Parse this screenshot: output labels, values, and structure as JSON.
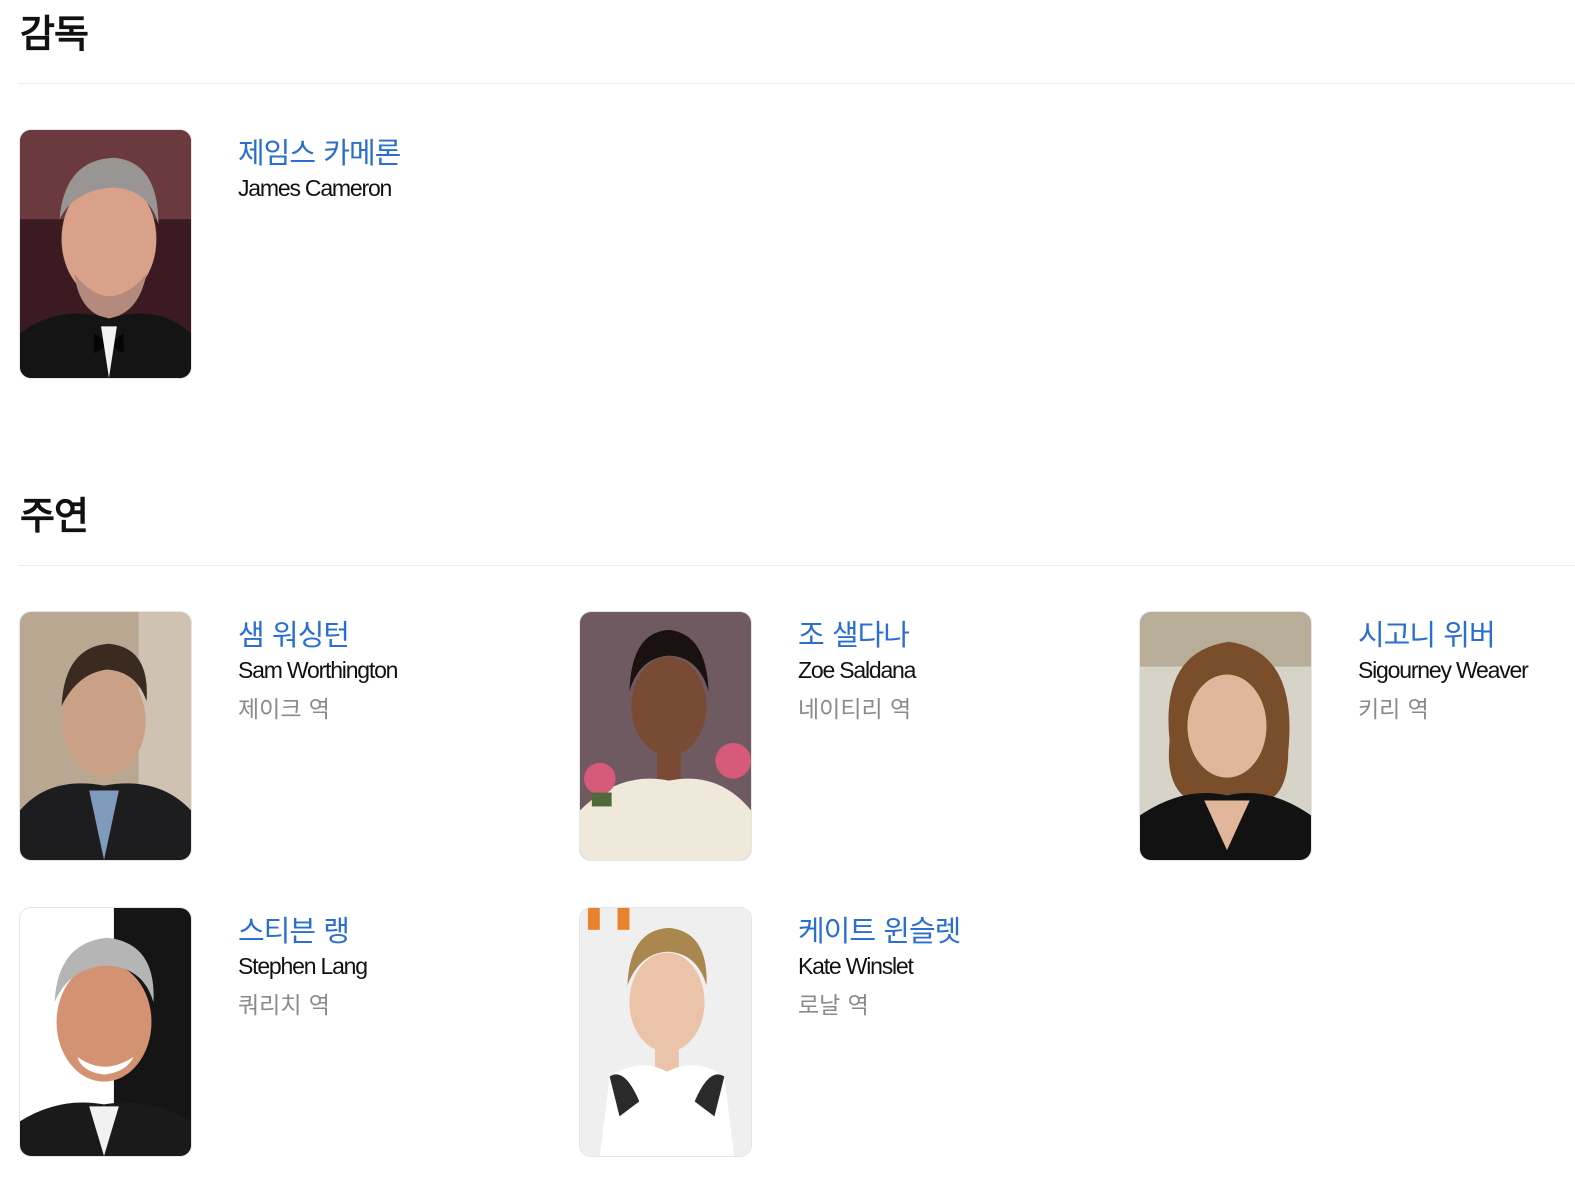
{
  "director_section": {
    "title": "감독",
    "people": [
      {
        "name_ko": "제임스 카메론",
        "name_en": "James Cameron",
        "photo_icon": "person-photo"
      }
    ]
  },
  "cast_section": {
    "title": "주연",
    "people": [
      {
        "name_ko": "샘 워싱턴",
        "name_en": "Sam Worthington",
        "role": "제이크 역",
        "photo_icon": "person-photo"
      },
      {
        "name_ko": "조 샐다나",
        "name_en": "Zoe Saldana",
        "role": "네이티리 역",
        "photo_icon": "person-photo"
      },
      {
        "name_ko": "시고니 위버",
        "name_en": "Sigourney Weaver",
        "role": "키리 역",
        "photo_icon": "person-photo"
      },
      {
        "name_ko": "스티븐 랭",
        "name_en": "Stephen Lang",
        "role": "쿼리치 역",
        "photo_icon": "person-photo"
      },
      {
        "name_ko": "케이트 윈슬렛",
        "name_en": "Kate Winslet",
        "role": "로날 역",
        "photo_icon": "person-photo"
      }
    ]
  },
  "colors": {
    "link": "#2a6fd0",
    "role_text": "#8a8a8a",
    "divider": "#ececec"
  }
}
